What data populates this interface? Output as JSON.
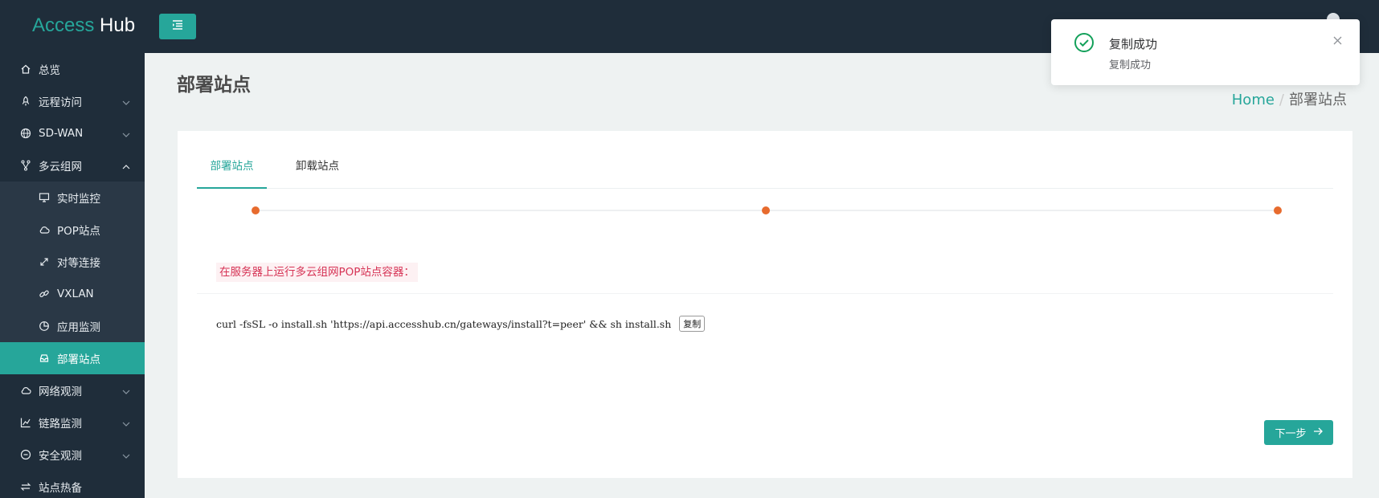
{
  "app": {
    "logo_part1": "Access",
    "logo_part2": " Hub"
  },
  "sidebar": {
    "items": [
      {
        "label": "总览",
        "icon": "home-icon"
      },
      {
        "label": "远程访问",
        "icon": "rocket-icon",
        "expandable": true
      },
      {
        "label": "SD-WAN",
        "icon": "globe-icon",
        "expandable": true
      },
      {
        "label": "多云组网",
        "icon": "branch-icon",
        "expandable": true,
        "expanded": true
      },
      {
        "label": "网络观测",
        "icon": "cloud-icon",
        "expandable": true
      },
      {
        "label": "链路监测",
        "icon": "line-chart-icon",
        "expandable": true
      },
      {
        "label": "安全观测",
        "icon": "minus-circle-icon",
        "expandable": true
      },
      {
        "label": "站点热备",
        "icon": "swap-icon"
      }
    ],
    "subitems": [
      {
        "label": "实时监控",
        "icon": "monitor-icon"
      },
      {
        "label": "POP站点",
        "icon": "cloud-icon"
      },
      {
        "label": "对等连接",
        "icon": "arrows-diagonal-icon"
      },
      {
        "label": "VXLAN",
        "icon": "link-icon"
      },
      {
        "label": "应用监测",
        "icon": "pie-chart-icon"
      },
      {
        "label": "部署站点",
        "icon": "inbox-icon",
        "active": true
      }
    ]
  },
  "page": {
    "title": "部署站点"
  },
  "breadcrumb": {
    "home": "Home",
    "separator": "/",
    "current": "部署站点"
  },
  "tabs": [
    {
      "label": "部署站点",
      "active": true
    },
    {
      "label": "卸载站点"
    }
  ],
  "steps": {
    "count": 3,
    "current": 1
  },
  "command": {
    "label": "在服务器上运行多云组网POP站点容器：",
    "text": "curl -fsSL -o install.sh 'https://api.accesshub.cn/gateways/install?t=peer' && sh install.sh",
    "copy_label": "复制"
  },
  "next_button": {
    "label": "下一步"
  },
  "toast": {
    "title": "复制成功",
    "message": "复制成功"
  },
  "colors": {
    "accent": "#26a69a",
    "sidebar_bg": "#1f2d3a",
    "step_dot": "#e76b2e",
    "label_red": "#d63355",
    "success": "#13a05a"
  }
}
